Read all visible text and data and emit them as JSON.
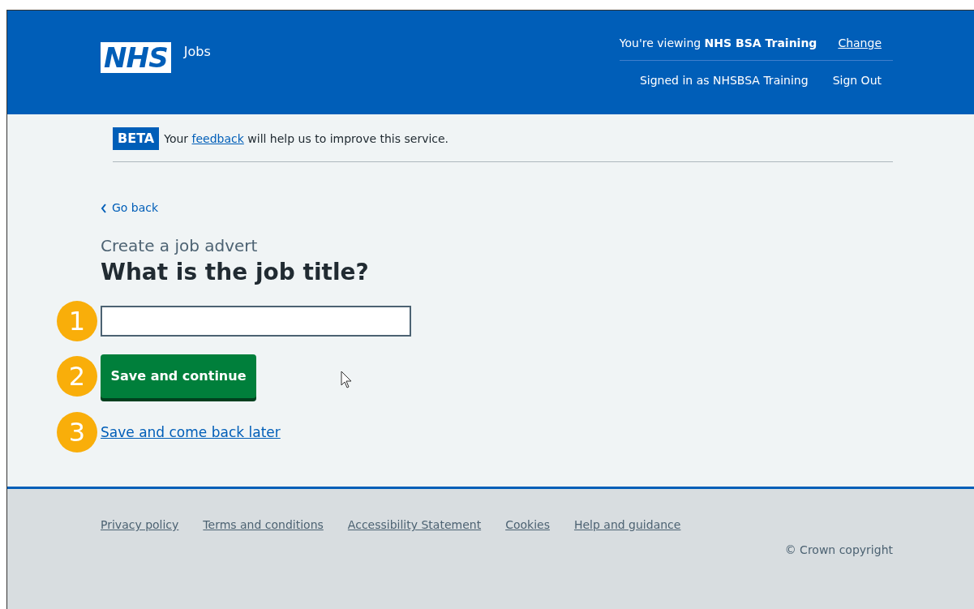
{
  "header": {
    "logo": "NHS",
    "service": "Jobs",
    "viewing_prefix": "You're viewing",
    "viewing_org": "NHS BSA Training",
    "change_link": "Change",
    "signed_in": "Signed in as NHSBSA Training",
    "sign_out": "Sign Out"
  },
  "beta_banner": {
    "tag": "BETA",
    "text_before": "Your",
    "link": "feedback",
    "text_after": "will help us to improve this service."
  },
  "back_link": "Go back",
  "caption": "Create a job advert",
  "heading": "What is the job title?",
  "callouts": [
    "1",
    "2",
    "3"
  ],
  "primary_button": "Save and continue",
  "secondary_link": "Save and come back later",
  "footer": {
    "links": [
      "Privacy policy",
      "Terms and conditions",
      "Accessibility Statement",
      "Cookies",
      "Help and guidance"
    ],
    "copyright": "© Crown copyright"
  }
}
